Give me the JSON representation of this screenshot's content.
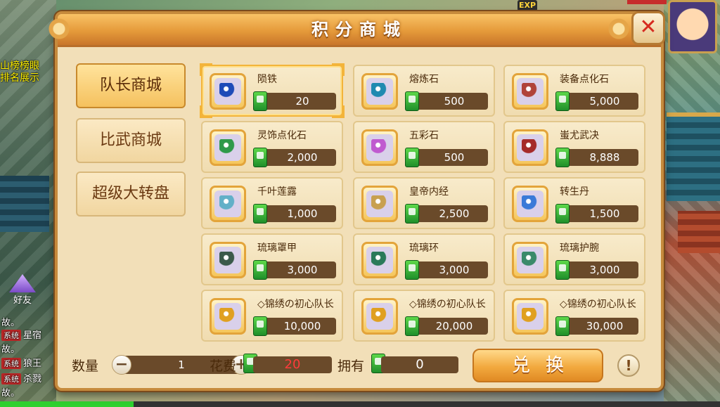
{
  "game_hud": {
    "rank_line1": "山榜榜眼",
    "rank_line2": "排名展示",
    "friend_label": "好友",
    "exp_badge": "EXP",
    "chat": [
      {
        "tag": "",
        "text": "故。"
      },
      {
        "tag": "系统",
        "text": "星宿"
      },
      {
        "tag": "",
        "text": "故。"
      },
      {
        "tag": "系统",
        "text": "狼王"
      },
      {
        "tag": "系统",
        "text": "杀戮"
      },
      {
        "tag": "",
        "text": "故。"
      }
    ]
  },
  "panel": {
    "title": "积分商城",
    "close_icon": "close-x-icon"
  },
  "tabs": [
    {
      "label": "队长商城",
      "active": true
    },
    {
      "label": "比武商城",
      "active": false
    },
    {
      "label": "超级大转盘",
      "active": false
    }
  ],
  "items": [
    {
      "name": "陨铁",
      "price": "20",
      "icon": "blue-ore-icon",
      "color": "#1d4bb8"
    },
    {
      "name": "熔炼石",
      "price": "500",
      "icon": "teal-stone-icon",
      "color": "#1f8ab0"
    },
    {
      "name": "装备点化石",
      "price": "5,000",
      "icon": "vase-icon",
      "color": "#b0433a"
    },
    {
      "name": "灵饰点化石",
      "price": "2,000",
      "icon": "green-vase-icon",
      "color": "#2f9a4a"
    },
    {
      "name": "五彩石",
      "price": "500",
      "icon": "crystal-icon",
      "color": "#c05ad0"
    },
    {
      "name": "蚩尤武决",
      "price": "8,888",
      "icon": "red-book-icon",
      "color": "#a52a2a"
    },
    {
      "name": "千叶莲露",
      "price": "1,000",
      "icon": "plant-icon",
      "color": "#62b0c8"
    },
    {
      "name": "皇帝内经",
      "price": "2,500",
      "icon": "scroll-book-icon",
      "color": "#c8a050"
    },
    {
      "name": "转生丹",
      "price": "1,500",
      "icon": "pill-icon",
      "color": "#3a7ad8"
    },
    {
      "name": "琉璃罩甲",
      "price": "3,000",
      "icon": "armor-icon",
      "color": "#3b5a4a"
    },
    {
      "name": "琉璃环",
      "price": "3,000",
      "icon": "ring-icon",
      "color": "#2a7a5a"
    },
    {
      "name": "琉璃护腕",
      "price": "3,000",
      "icon": "bracer-icon",
      "color": "#3a8a6a"
    },
    {
      "name": "◇锦绣の初心队长",
      "price": "10,000",
      "icon": "gift-scroll-icon",
      "color": "#e0a020"
    },
    {
      "name": "◇锦绣の初心队长",
      "price": "20,000",
      "icon": "gift-scroll-icon",
      "color": "#e0a020"
    },
    {
      "name": "◇锦绣の初心队长",
      "price": "30,000",
      "icon": "gift-scroll-icon",
      "color": "#e0a020"
    }
  ],
  "bottom": {
    "quantity_label": "数量",
    "quantity_value": "1",
    "minus_icon": "minus-icon",
    "plus_icon": "plus-icon",
    "cost_label": "花费",
    "cost_value": "20",
    "cost_color": "#ff3b3b",
    "owned_label": "拥有",
    "owned_value": "0",
    "redeem_label": "兑换",
    "help_symbol": "!"
  }
}
